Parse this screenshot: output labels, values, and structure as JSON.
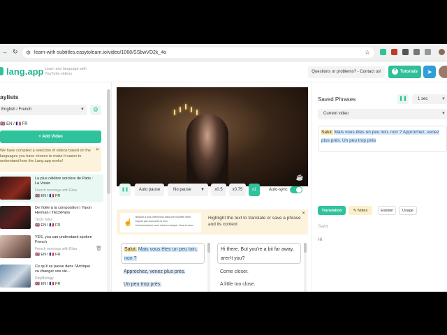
{
  "browser": {
    "url": "learn-with-subtitles.easytolearn.io/video/1068/SSbwVD2k_4o"
  },
  "header": {
    "logo": "lang.app",
    "tagline": "Learn any language with YouTube videos",
    "contact_label": "Questions or problems? - Contact us!",
    "tutorials_label": "Tutorials",
    "tutorials_icon": "question-circle-icon",
    "telegram_icon": "telegram-icon"
  },
  "sidebar": {
    "title": "aylists",
    "language_select": "English / French",
    "flags_label": "🇬🇧 EN / 🇫🇷 FR",
    "add_video_label": "Add Video",
    "notice_text": "We have compiled a selection of videos based on the languages you have chosen to make it easier to understand how the Lang.app works!",
    "videos": [
      {
        "title": "La plus célèbre sorcière de Paris : La Voisin",
        "channel": "French mornings with Elisa",
        "flags": "🇬🇧 EN / 🇫🇷 FR"
      },
      {
        "title": "De l'idée à la composition | Yaron Herman | TEDxParis",
        "channel": "TEDx Talks",
        "flags": "🇬🇧 EN / 🇫🇷 FR"
      },
      {
        "title": "YES, you can understand spoken French",
        "channel": "French mornings with Elisa",
        "flags": "🇬🇧 EN / 🇫🇷 FR"
      },
      {
        "title": "Ce qu'il se passe dans l'Arctique va changer vos vie...",
        "channel": "DirtyBiology",
        "flags": "🇬🇧 EN / 🇫🇷 FR"
      }
    ]
  },
  "player": {
    "auto_pause": "Auto pause",
    "no_pause": "No pause",
    "speed_05": "x0.5",
    "speed_075": "x0.75",
    "speed_1": "x1",
    "auto_sync": "Auto-sync",
    "auto_sync_on": true
  },
  "hint": {
    "mini_line1": "Bonjour à tous, bienvenue dans une nouvelle vidéo",
    "mini_line2": "Depuis que vous avez lu mon",
    "mini_line3": "l'environnement, vous n'aurez manqué. Vous en avez",
    "text": "Highlight the text to translate or save a phrase and its context"
  },
  "subtitles_fr": {
    "word_salut": "Salut.",
    "rest": "Mais vous êtes un peu loin, non ?",
    "line2": "Approchez, venez plus près.",
    "line3": "Un peu trop près."
  },
  "subtitles_en": {
    "line1": "Hi there. But you're a bit far away, aren't you?",
    "line2": "Come closer.",
    "line3": "A little too close."
  },
  "saved": {
    "title": "Saved Phrases",
    "seconds_select": "1 sec",
    "video_select": "Current video",
    "phrase_salut": "Salut.",
    "phrase_rest": "Mais vous êtes un peu loin, non ? Approchez, venez plus près. Un peu trop près"
  },
  "translation_panel": {
    "tab_translation": "Translation",
    "tab_notes": "Notes",
    "tab_explain": "Explain",
    "tab_usage": "Usage",
    "source": "Salut",
    "result": "Hi"
  }
}
